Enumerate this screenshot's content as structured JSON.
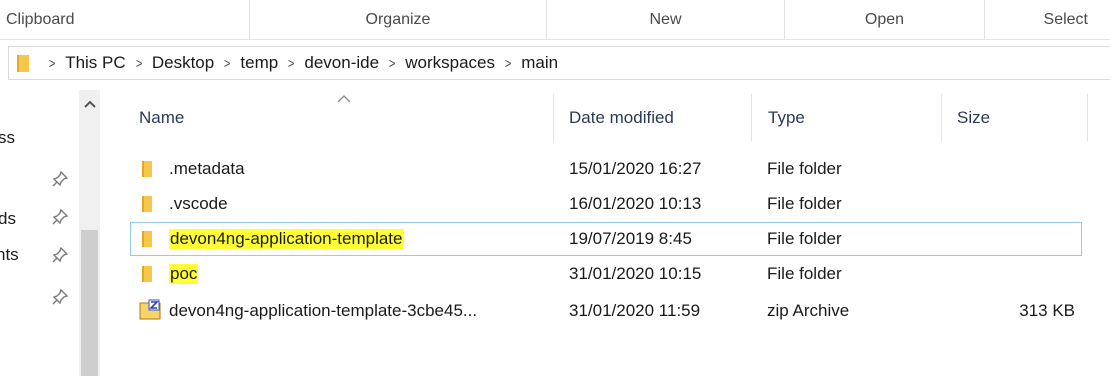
{
  "ribbon": {
    "groups": [
      "Clipboard",
      "Organize",
      "New",
      "Open",
      "Select"
    ]
  },
  "address": {
    "crumbs": [
      "This PC",
      "Desktop",
      "temp",
      "devon-ide",
      "workspaces",
      "main"
    ]
  },
  "nav": {
    "items": [
      "ss",
      "ds",
      "nts"
    ]
  },
  "columns": {
    "name": "Name",
    "date": "Date modified",
    "type": "Type",
    "size": "Size"
  },
  "files": [
    {
      "name": ".metadata",
      "date": "15/01/2020 16:27",
      "type": "File folder",
      "size": ""
    },
    {
      "name": ".vscode",
      "date": "16/01/2020 10:13",
      "type": "File folder",
      "size": ""
    },
    {
      "name": "devon4ng-application-template",
      "date": "19/07/2019 8:45",
      "type": "File folder",
      "size": ""
    },
    {
      "name": "poc",
      "date": "31/01/2020 10:15",
      "type": "File folder",
      "size": ""
    },
    {
      "name": "devon4ng-application-template-3cbe45...",
      "date": "31/01/2020 11:59",
      "type": "zip Archive",
      "size": "313 KB"
    }
  ],
  "colors": {
    "highlight": "#ffff33",
    "selection_border": "#99c9ef",
    "folder": "#f0c24a"
  }
}
